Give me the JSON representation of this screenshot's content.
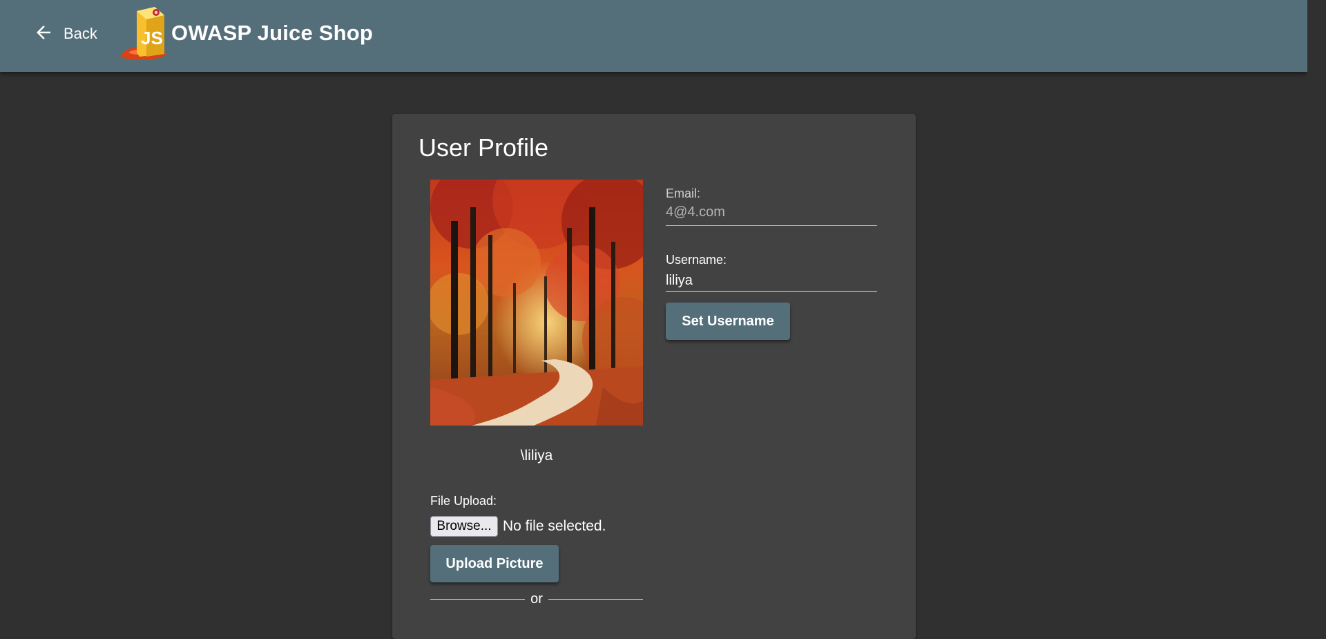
{
  "header": {
    "back_label": "Back",
    "app_title": "OWASP Juice Shop",
    "colors": {
      "toolbar": "#546e7a"
    }
  },
  "profile": {
    "title": "User Profile",
    "display_name": "\\liliya",
    "email": {
      "label": "Email:",
      "value": "4@4.com"
    },
    "username": {
      "label": "Username:",
      "value": "liliya"
    },
    "set_username_label": "Set Username",
    "file_upload": {
      "label": "File Upload:",
      "browse_label": "Browse...",
      "status": "No file selected.",
      "upload_label": "Upload Picture"
    },
    "divider_text": "or"
  },
  "colors": {
    "background": "#303030",
    "card": "#424242",
    "accent_button": "#546e7a"
  },
  "icons": {
    "back": "arrow-left-icon",
    "logo": "juice-shop-logo"
  }
}
